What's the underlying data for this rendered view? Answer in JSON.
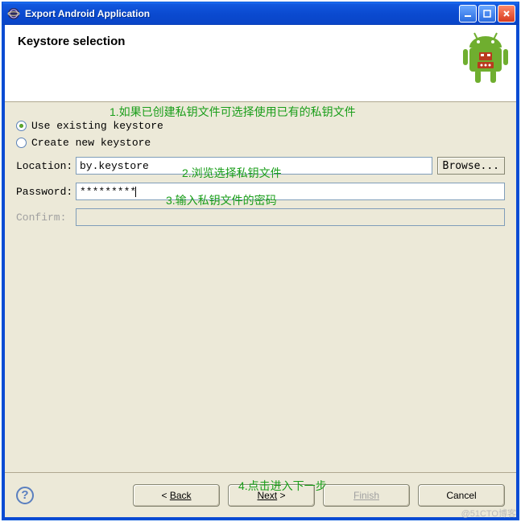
{
  "titlebar": {
    "title": "Export Android Application",
    "min_tooltip": "Minimize",
    "max_tooltip": "Maximize",
    "close_tooltip": "Close"
  },
  "banner": {
    "title": "Keystore selection"
  },
  "annotations": {
    "a1": "1.如果已创建私钥文件可选择使用已有的私钥文件",
    "a2": "2.浏览选择私钥文件",
    "a3": "3.输入私钥文件的密码",
    "a4": "4.点击进入下一步"
  },
  "radios": {
    "use_existing": "Use existing keystore",
    "create_new": "Create new keystore"
  },
  "fields": {
    "location_label": "Location:",
    "location_value": "by.keystore",
    "password_label": "Password:",
    "password_value": "*********",
    "confirm_label": "Confirm:",
    "confirm_value": ""
  },
  "buttons": {
    "browse": "Browse...",
    "back_caret": "<",
    "back": "Back",
    "next": "Next",
    "next_caret": ">",
    "finish": "Finish",
    "cancel": "Cancel",
    "help": "?"
  },
  "watermark": "@51CTO博客"
}
